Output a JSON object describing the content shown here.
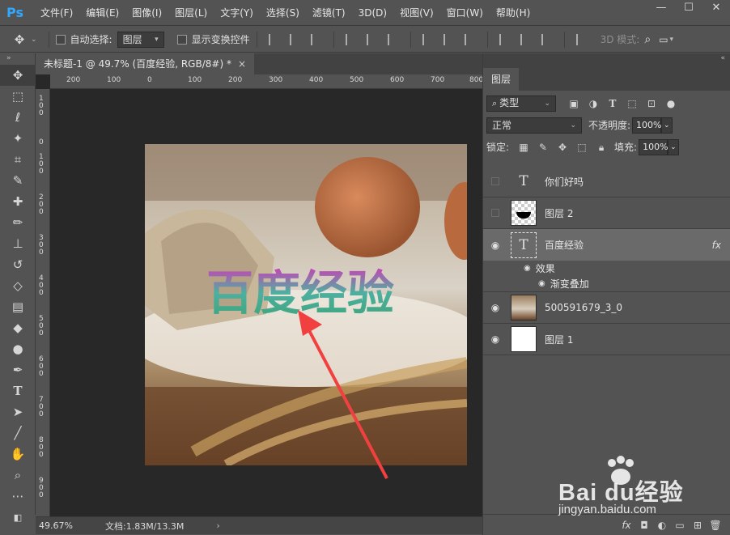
{
  "app": {
    "logo": "Ps",
    "menu": [
      "文件(F)",
      "编辑(E)",
      "图像(I)",
      "图层(L)",
      "文字(Y)",
      "选择(S)",
      "滤镜(T)",
      "3D(D)",
      "视图(V)",
      "窗口(W)",
      "帮助(H)"
    ],
    "window_controls": {
      "minimize": "—",
      "maximize": "☐",
      "close": "✕"
    }
  },
  "options_bar": {
    "auto_select_label": "自动选择:",
    "auto_select_value": "图层",
    "show_transform_label": "显示变换控件",
    "mode_3d_label": "3D 模式:"
  },
  "document": {
    "tab_title": "未标题-1 @ 49.7% (百度经验, RGB/8#) *",
    "tab_close": "×",
    "canvas_text": "百度经验",
    "ruler_h_labels": [
      "200",
      "100",
      "0",
      "100",
      "200",
      "300",
      "400",
      "500",
      "600",
      "700",
      "800"
    ],
    "ruler_v_labels": [
      "1 0 0",
      "0",
      "1 0 0",
      "2 0 0",
      "3 0 0",
      "4 0 0",
      "5 0 0",
      "6 0 0",
      "7 0 0",
      "8 0 0",
      "9 0 0"
    ]
  },
  "status": {
    "zoom": "49.67%",
    "doc_info": "文档:1.83M/13.3M",
    "arrow": "›"
  },
  "layers_panel": {
    "tab": "图层",
    "filter_kind": "类型",
    "blend_mode": "正常",
    "opacity_label": "不透明度:",
    "opacity_value": "100%",
    "lock_label": "锁定:",
    "fill_label": "填充:",
    "fill_value": "100%",
    "layers": [
      {
        "name": "你们好吗",
        "type": "text",
        "visible": false
      },
      {
        "name": "图层 2",
        "type": "shape",
        "visible": false
      },
      {
        "name": "百度经验",
        "type": "text",
        "visible": true,
        "selected": true,
        "fx": "fx"
      },
      {
        "name": "500591679_3_0",
        "type": "image",
        "visible": true
      },
      {
        "name": "图层 1",
        "type": "fill",
        "visible": true
      }
    ],
    "effects_label": "效果",
    "gradient_overlay_label": "渐变叠加"
  },
  "watermark": {
    "brand": "Bai du经验",
    "url": "jingyan.baidu.com"
  },
  "colors": {
    "ps_blue": "#31a8ff",
    "text_gradient_top": "#d23ab8",
    "text_gradient_bottom": "#3fa47a",
    "arrow": "#f04040"
  }
}
